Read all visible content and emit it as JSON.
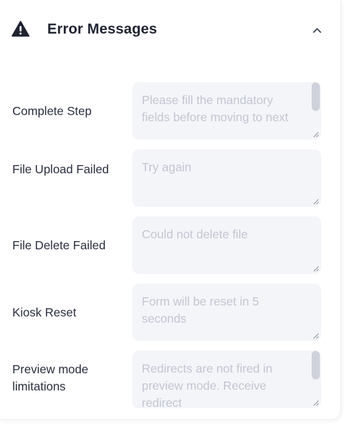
{
  "section": {
    "title": "Error Messages",
    "icon": "warning-icon",
    "collapse_icon": "chevron-up-icon",
    "expanded": true
  },
  "messages": [
    {
      "label": "Complete Step",
      "placeholder": "Please fill the mandatory fields before moving to next"
    },
    {
      "label": "File Upload Failed",
      "placeholder": "Try again"
    },
    {
      "label": "File Delete Failed",
      "placeholder": "Could not delete file"
    },
    {
      "label": "Kiosk Reset",
      "placeholder": "Form will be reset in 5 seconds"
    },
    {
      "label": "Preview mode limitations",
      "placeholder": "Redirects are not fired in preview mode. Receive redirect"
    }
  ],
  "colors": {
    "text": "#2a2f3f",
    "placeholder": "#c3c6d1",
    "field_bg": "#f4f5f9"
  }
}
